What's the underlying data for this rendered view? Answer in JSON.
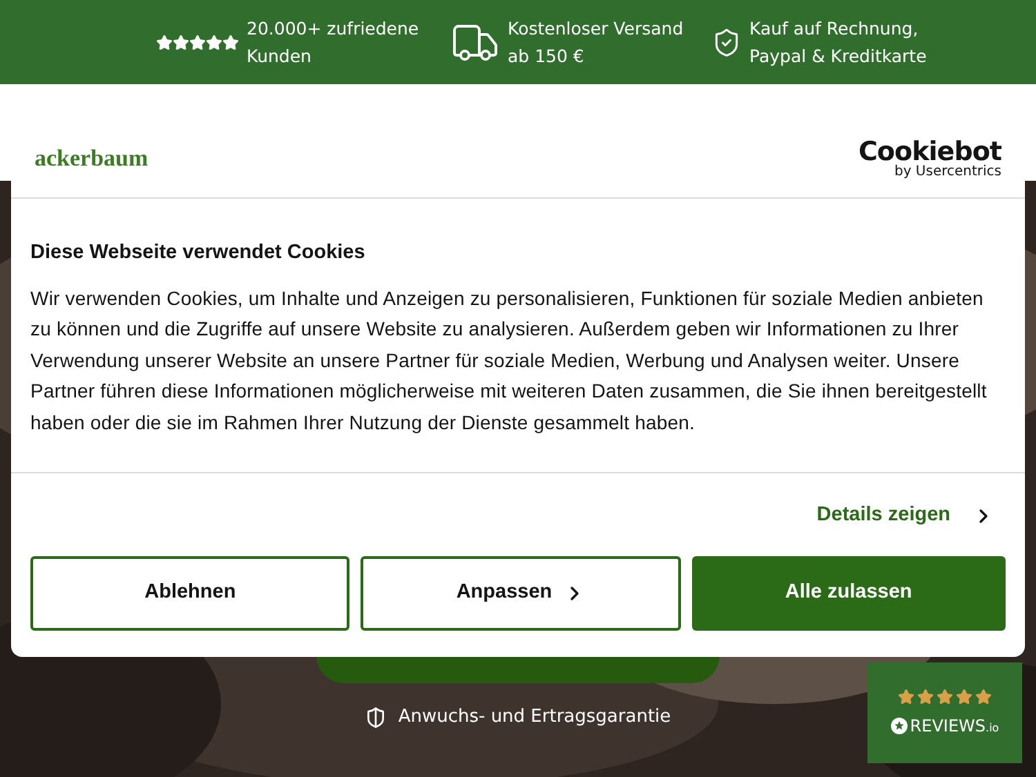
{
  "top_bar": {
    "items": [
      {
        "kind": "stars",
        "text": "20.000+ zufriedene Kunden"
      },
      {
        "kind": "truck",
        "text": "Kostenloser Versand ab 150 €"
      },
      {
        "kind": "shield",
        "text": "Kauf auf Rechnung, Paypal & Kreditkarte"
      }
    ]
  },
  "hero": {
    "guarantee": "Anwuchs- und Ertragsgarantie"
  },
  "reviews_badge": {
    "stars": 5,
    "brand": "REVIEWS",
    "suffix": ".io"
  },
  "cookie_dialog": {
    "logo": "ackerbaum",
    "provider": "Cookiebot",
    "provider_sub": "by Usercentrics",
    "title": "Diese Webseite verwendet Cookies",
    "body": "Wir verwenden Cookies, um Inhalte und Anzeigen zu personalisieren, Funktionen für soziale Medien anbieten zu können und die Zugriffe auf unsere Website zu analysieren. Außerdem geben wir Informationen zu Ihrer Verwendung unserer Website an unsere Partner für soziale Medien, Werbung und Analysen weiter. Unsere Partner führen diese Informationen möglicherweise mit weiteren Daten zusammen, die Sie ihnen bereitgestellt haben oder die sie im Rahmen Ihrer Nutzung der Dienste gesammelt haben.",
    "details_link": "Details zeigen",
    "buttons": [
      {
        "kind": "outline",
        "label": "Ablehnen"
      },
      {
        "kind": "outline-arrow",
        "label": "Anpassen"
      },
      {
        "kind": "primary",
        "label": "Alle zulassen"
      }
    ]
  }
}
